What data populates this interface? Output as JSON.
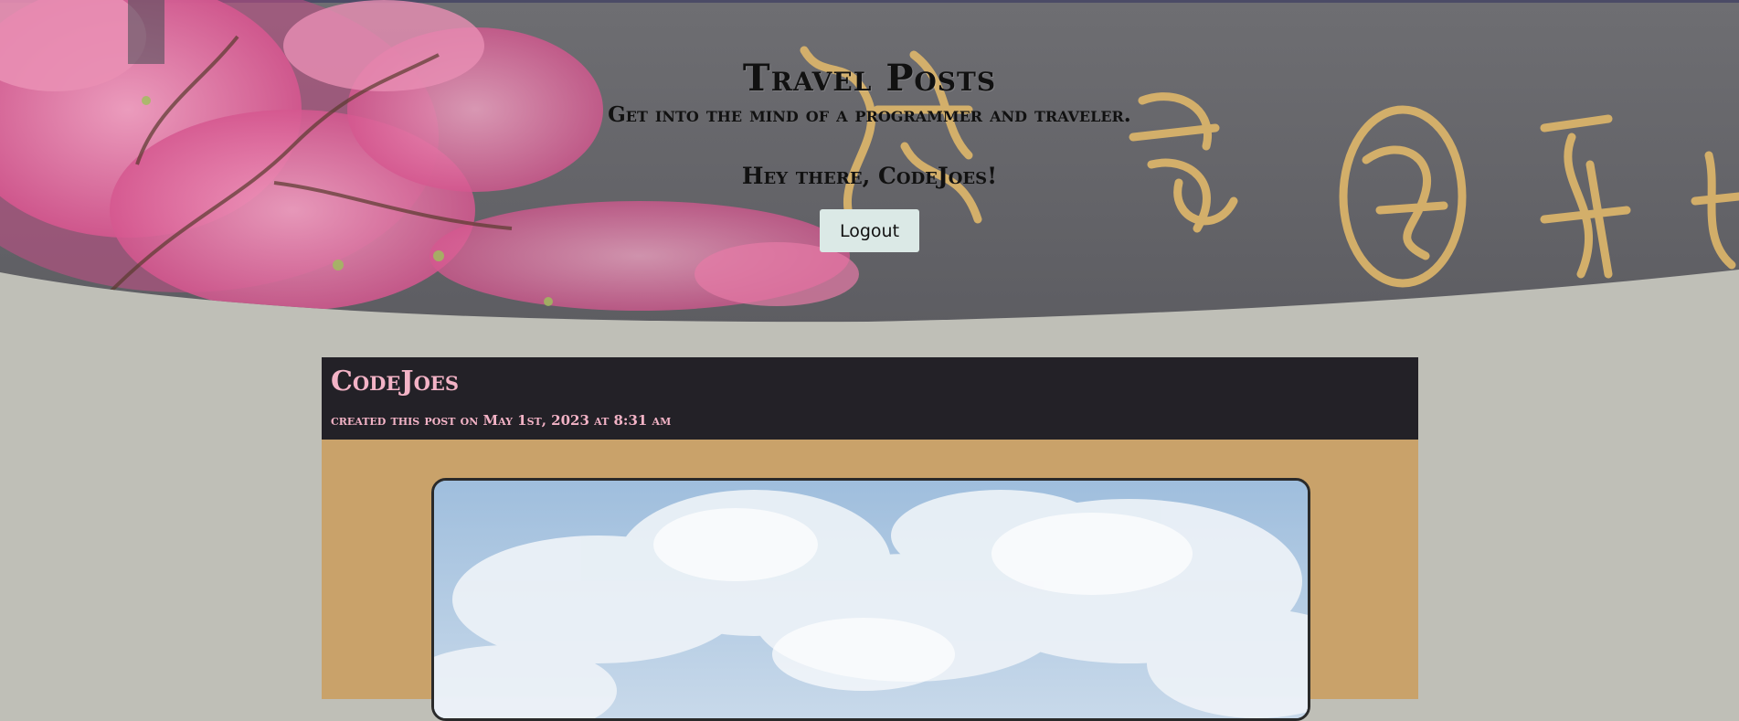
{
  "hero": {
    "title": "Travel Posts",
    "tagline": "Get into the mind of a programmer and traveler.",
    "greeting": "Hey there, CodeJoes!",
    "logout_label": "Logout",
    "background_icon": "cherry-blossom-wall-photo"
  },
  "post": {
    "author": "CodeJoes",
    "meta": "created this post on May 1st, 2023 at 8:31 am",
    "photo_icon": "sky-clouds-photo"
  },
  "colors": {
    "page_bg": "#bfbfb7",
    "post_header_bg": "#232127",
    "post_body_bg": "#c9a26a",
    "accent_pink": "#f3b3c6",
    "button_bg": "#dbe9e6"
  }
}
